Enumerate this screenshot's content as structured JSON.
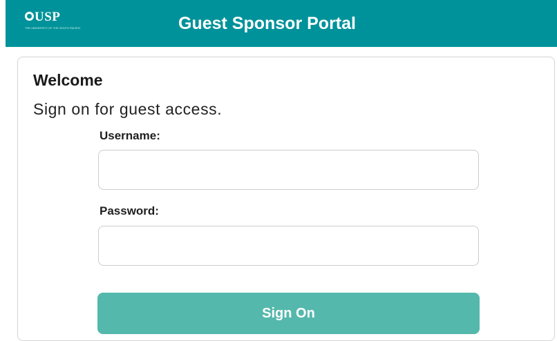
{
  "header": {
    "logo_text": "USP",
    "logo_subtext": "THE UNIVERSITY OF THE SOUTH PACIFIC",
    "title": "Guest Sponsor Portal"
  },
  "login": {
    "heading": "Welcome",
    "subtitle": "Sign on for guest access.",
    "username_label": "Username:",
    "username_value": "",
    "password_label": "Password:",
    "password_value": "",
    "submit_label": "Sign On"
  },
  "colors": {
    "header_bg": "#00929a",
    "button_bg": "#55b8ac",
    "card_border": "#d4d4d4"
  }
}
